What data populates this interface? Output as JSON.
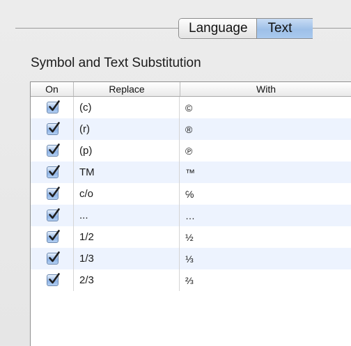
{
  "tabs": [
    {
      "label": "Language",
      "active": false
    },
    {
      "label": "Text",
      "active": true
    }
  ],
  "section_title": "Symbol and Text Substitution",
  "table": {
    "columns": {
      "on": "On",
      "replace": "Replace",
      "with": "With"
    },
    "rows": [
      {
        "on": true,
        "replace": "(c)",
        "with": "©"
      },
      {
        "on": true,
        "replace": "(r)",
        "with": "®"
      },
      {
        "on": true,
        "replace": "(p)",
        "with": "℗"
      },
      {
        "on": true,
        "replace": "TM",
        "with": "™"
      },
      {
        "on": true,
        "replace": "c/o",
        "with": "℅"
      },
      {
        "on": true,
        "replace": "...",
        "with": "…"
      },
      {
        "on": true,
        "replace": "1/2",
        "with": "½"
      },
      {
        "on": true,
        "replace": "1/3",
        "with": "⅓"
      },
      {
        "on": true,
        "replace": "2/3",
        "with": "⅔"
      }
    ]
  },
  "colors": {
    "checkbox_fill": "#8fb4e6",
    "checkmark": "#1f1f1f",
    "selected_tab": "#9ec0e8",
    "alt_row": "#edf3fe"
  }
}
